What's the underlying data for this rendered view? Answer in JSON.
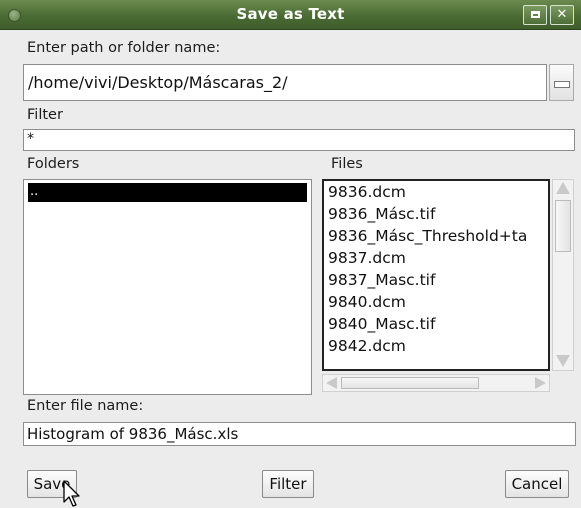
{
  "window": {
    "title": "Save as Text"
  },
  "path": {
    "label": "Enter path or folder name:",
    "value": "/home/vivi/Desktop/Máscaras_2/"
  },
  "filter": {
    "label": "Filter",
    "value": "*"
  },
  "folders": {
    "label": "Folders",
    "items": [
      ".."
    ]
  },
  "files": {
    "label": "Files",
    "items": [
      "9836.dcm",
      "9836_Másc.tif",
      "9836_Másc_Threshold+ta",
      "9837.dcm",
      "9837_Masc.tif",
      "9840.dcm",
      "9840_Masc.tif",
      "9842.dcm"
    ]
  },
  "filename": {
    "label": "Enter file name:",
    "value": "Histogram of 9836_Másc.xls"
  },
  "buttons": {
    "save": "Save",
    "filter": "Filter",
    "cancel": "Cancel"
  },
  "colors": {
    "titlebar": "#4a6b34",
    "selection": "#000000"
  }
}
